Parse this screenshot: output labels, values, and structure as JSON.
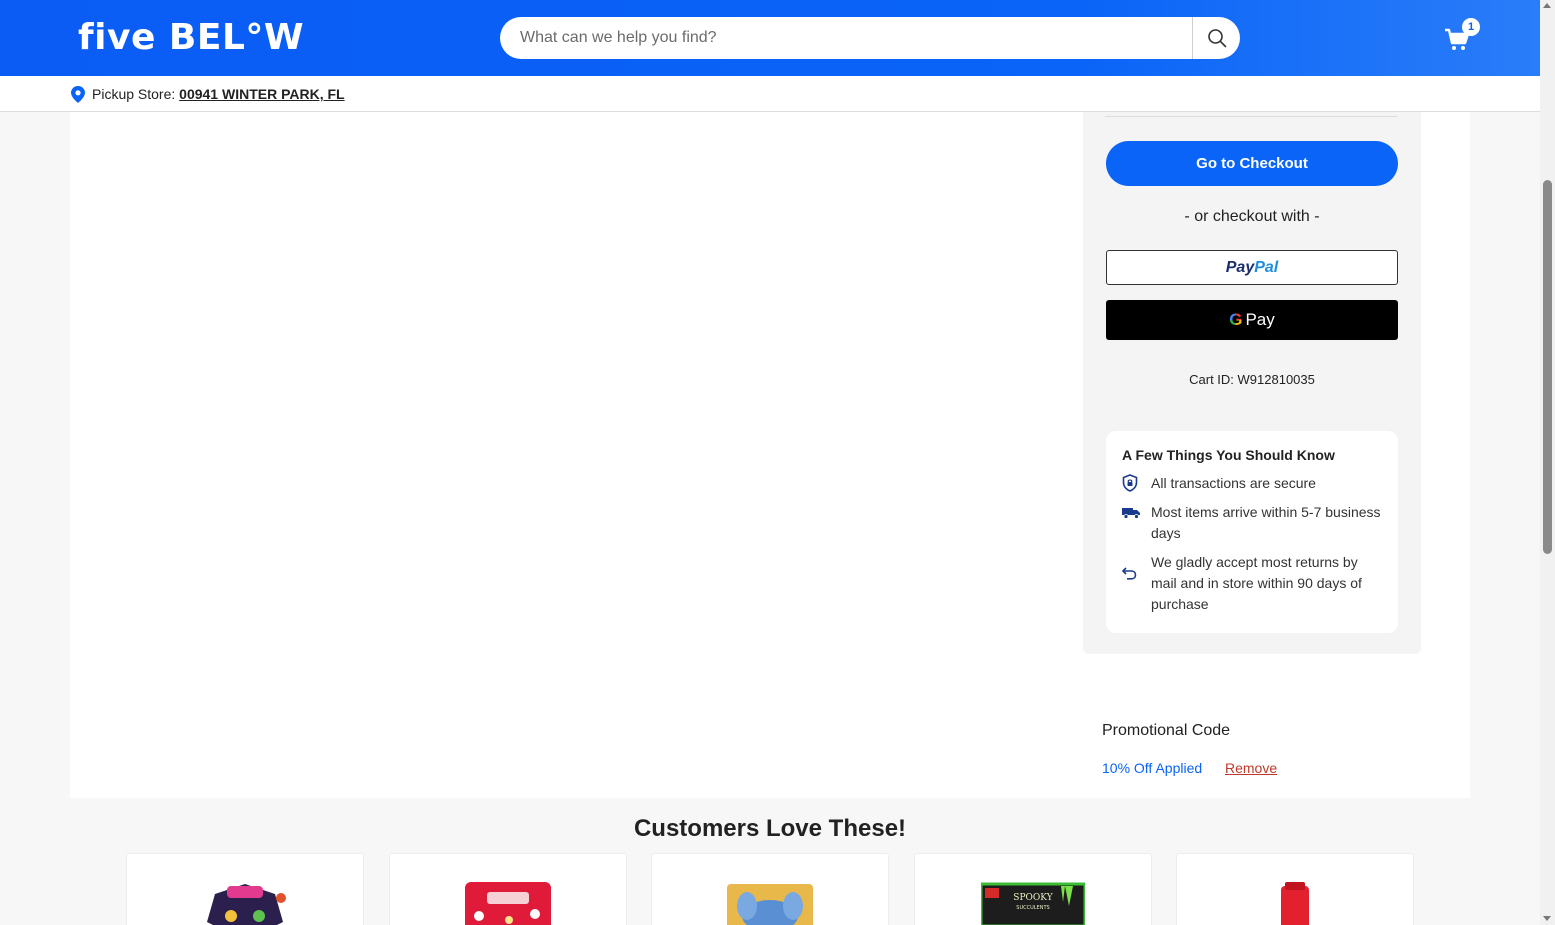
{
  "header": {
    "logo_text": "five BEL°W",
    "search_placeholder": "What can we help you find?",
    "cart_count": "1"
  },
  "pickup": {
    "label": "Pickup Store:",
    "store": "00941 WINTER PARK, FL"
  },
  "summary": {
    "checkout_label": "Go to Checkout",
    "or_text": "- or checkout with -",
    "paypal_part1": "Pay",
    "paypal_part2": "Pal",
    "gpay_g": "G",
    "gpay_label": "Pay",
    "cart_id": "Cart ID: W912810035"
  },
  "know": {
    "title": "A Few Things You Should Know",
    "items": [
      {
        "icon": "shield-lock-icon",
        "text": "All transactions are secure"
      },
      {
        "icon": "truck-icon",
        "text": "Most items arrive within 5-7 business days"
      },
      {
        "icon": "return-arrow-icon",
        "text": "We gladly accept most returns by mail and in store within 90 days of purchase"
      }
    ]
  },
  "promo": {
    "title": "Promotional Code",
    "applied": "10% Off Applied",
    "remove": "Remove"
  },
  "recommendations": {
    "title": "Customers Love These!"
  },
  "colors": {
    "brand_blue": "#0a64f7",
    "remove_red": "#c0392b"
  }
}
